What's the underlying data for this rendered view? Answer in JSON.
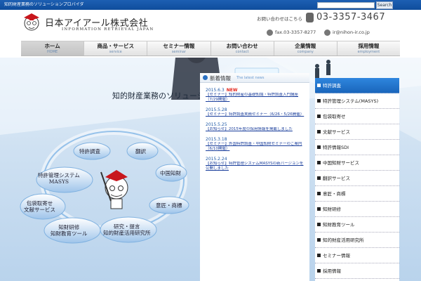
{
  "topbar": {
    "tagline": "知的財産業務のソリューションプロバイダー　日本アイアール株式会社",
    "search_placeholder": "",
    "search_label": "Search"
  },
  "header": {
    "company_name": "日本アイアール株式会社",
    "company_sub": "INFORMATION RETRIEVAL JAPAN",
    "contact_label": "お問い合わせはこちら",
    "phone": "03-3357-3467",
    "fax": "fax.03-3357-8277",
    "email": "ir@nihon-ir.co.jp"
  },
  "nav": [
    {
      "jp": "ホーム",
      "en": "HOME"
    },
    {
      "jp": "商品・サービス",
      "en": "service"
    },
    {
      "jp": "セミナー情報",
      "en": "seminar"
    },
    {
      "jp": "お問い合わせ",
      "en": "contact"
    },
    {
      "jp": "企業情報",
      "en": "company"
    },
    {
      "jp": "採用情報",
      "en": "employment"
    }
  ],
  "hero": {
    "headline": "知的財産業務のソリューションプロバイダー"
  },
  "services": {
    "patent_search": "特許調査",
    "translation": "翻訳",
    "china_ip": "中国知財",
    "management_system": "特許管理システム",
    "masys": "MASYS",
    "document_service_1": "包袋取寄せ",
    "document_service_2": "文献サービス",
    "design_trademark": "意匠・商標",
    "ip_training_1": "知財研修",
    "ip_training_2": "知財教育ツール",
    "research_1": "研究・提言",
    "research_2": "知的財産活用研究所"
  },
  "news": {
    "title": "新着情報",
    "subtitle": "The latest news",
    "items": [
      {
        "date": "2015.6.3",
        "is_new": true,
        "new_label": "NEW",
        "text": "【セミナー】知的財産の基礎知識・特許調査入門講座（7/29開催）"
      },
      {
        "date": "2015.5.28",
        "is_new": false,
        "new_label": "",
        "text": "【セミナー】特許調査実務セミナー（6/26・5/26開催）"
      },
      {
        "date": "2015.5.25",
        "is_new": false,
        "new_label": "",
        "text": "【お知らせ】2015年度の採用情報を掲載しました"
      },
      {
        "date": "2015.3.18",
        "is_new": false,
        "new_label": "",
        "text": "【セミナー】外国特許調査・中国知財セミナーのご案内（6/10開催）"
      },
      {
        "date": "2015.2.24",
        "is_new": false,
        "new_label": "",
        "text": "【お知らせ】特許管理システムMASYSの新バージョンを公開しました"
      }
    ]
  },
  "sidebar": {
    "items": [
      {
        "label": "特許調査"
      },
      {
        "label": "特許管理システム(MASYS)"
      },
      {
        "label": "包袋取寄せ"
      },
      {
        "label": "文献サービス"
      },
      {
        "label": "特許情報SDI"
      },
      {
        "label": "中国知財サービス"
      },
      {
        "label": "翻訳サービス"
      },
      {
        "label": "意匠・商標"
      },
      {
        "label": "知財研修"
      },
      {
        "label": "知財教育ツール"
      },
      {
        "label": "知的財産活用研究所"
      },
      {
        "label": "セミナー情報"
      },
      {
        "label": "採用情報"
      }
    ]
  },
  "colors": {
    "topbar_blue": "#1d5fb3",
    "accent_blue": "#2a70c2",
    "new_red": "#e2231a"
  }
}
